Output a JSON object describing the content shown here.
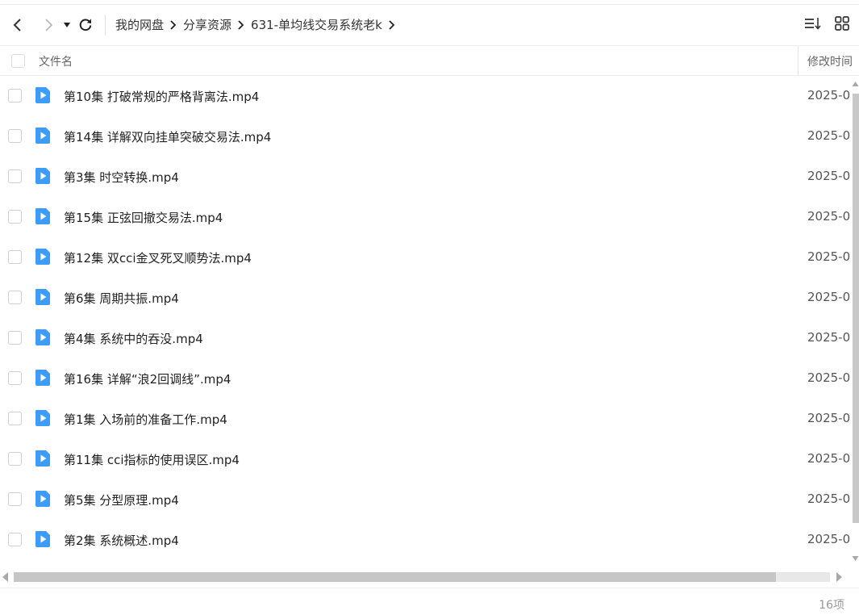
{
  "toolbar": {
    "breadcrumb": [
      "我的网盘",
      "分享资源",
      "631-单均线交易系统老k"
    ]
  },
  "header": {
    "name_label": "文件名",
    "time_label": "修改时间"
  },
  "files": [
    {
      "name": "第10集 打破常规的严格背离法.mp4",
      "time": "2025-0"
    },
    {
      "name": "第14集 详解双向挂单突破交易法.mp4",
      "time": "2025-0"
    },
    {
      "name": "第3集 时空转换.mp4",
      "time": "2025-0"
    },
    {
      "name": "第15集 正弦回撤交易法.mp4",
      "time": "2025-0"
    },
    {
      "name": "第12集 双cci金叉死叉顺势法.mp4",
      "time": "2025-0"
    },
    {
      "name": "第6集 周期共振.mp4",
      "time": "2025-0"
    },
    {
      "name": "第4集 系统中的吞没.mp4",
      "time": "2025-0"
    },
    {
      "name": "第16集 详解“浪2回调线”.mp4",
      "time": "2025-0"
    },
    {
      "name": "第1集 入场前的准备工作.mp4",
      "time": "2025-0"
    },
    {
      "name": "第11集 cci指标的使用误区.mp4",
      "time": "2025-0"
    },
    {
      "name": "第5集 分型原理.mp4",
      "time": "2025-0"
    },
    {
      "name": "第2集 系统概述.mp4",
      "time": "2025-0"
    }
  ],
  "status": {
    "item_count": "16项"
  },
  "colors": {
    "video_icon": "#3d9cf5"
  }
}
